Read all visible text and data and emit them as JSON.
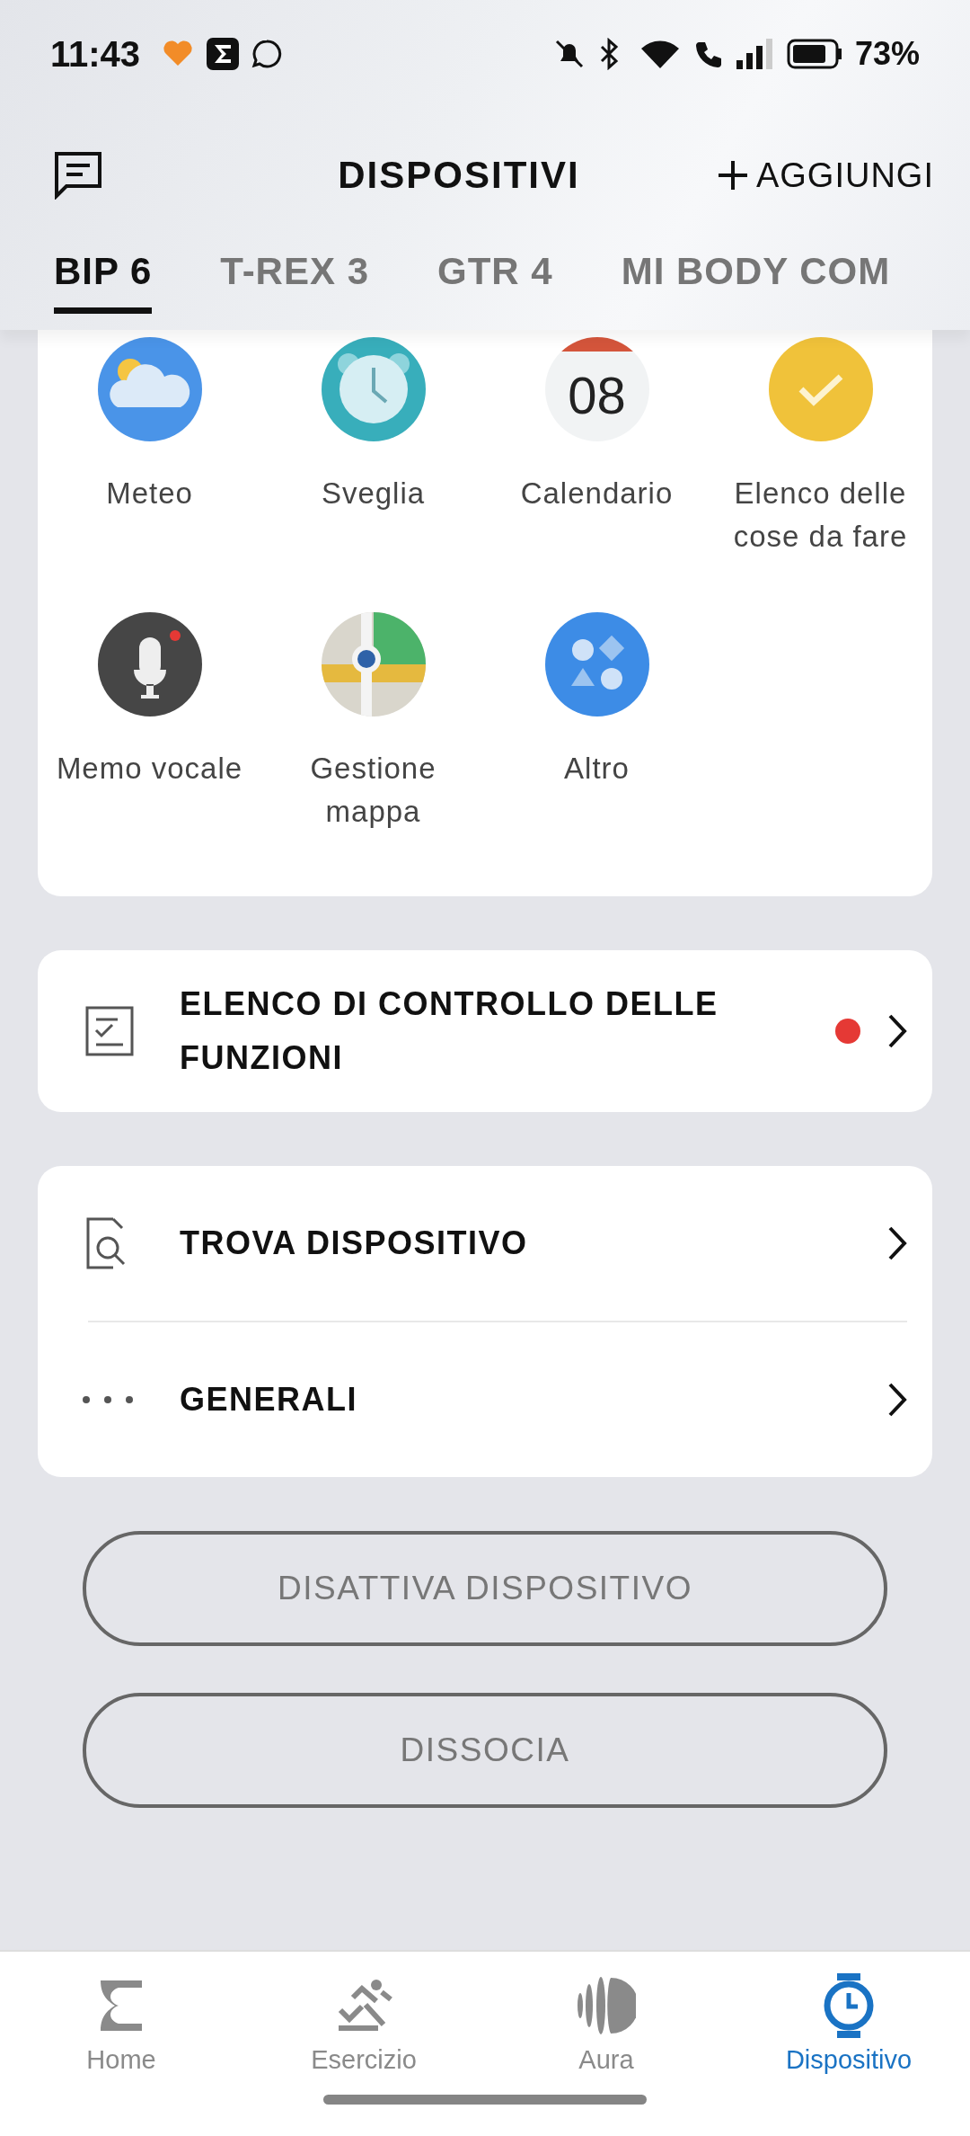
{
  "status_bar": {
    "time": "11:43",
    "battery": "73%"
  },
  "header": {
    "title": "DISPOSITIVI",
    "add_button": "AGGIUNGI"
  },
  "tabs": [
    {
      "label": "BIP 6",
      "selected": true
    },
    {
      "label": "T-REX 3",
      "selected": false
    },
    {
      "label": "GTR 4",
      "selected": false
    },
    {
      "label": "MI BODY COM",
      "selected": false
    }
  ],
  "apps": [
    {
      "label": "Meteo",
      "kind": "weather"
    },
    {
      "label": "Sveglia",
      "kind": "alarm"
    },
    {
      "label": "Calendario",
      "kind": "calendar",
      "icon_text": "08"
    },
    {
      "label": "Elenco delle cose da fare",
      "kind": "todo"
    },
    {
      "label": "Memo vocale",
      "kind": "voice"
    },
    {
      "label": "Gestione mappa",
      "kind": "map"
    },
    {
      "label": "Altro",
      "kind": "more"
    }
  ],
  "checklist": {
    "label": "ELENCO DI CONTROLLO DELLE FUNZIONI",
    "alert": true
  },
  "settings": [
    {
      "label": "TROVA DISPOSITIVO",
      "kind": "find"
    },
    {
      "label": "GENERALI",
      "kind": "general"
    }
  ],
  "actions": [
    "DISATTIVA DISPOSITIVO",
    "DISSOCIA"
  ],
  "nav": [
    {
      "label": "Home",
      "kind": "home",
      "selected": false
    },
    {
      "label": "Esercizio",
      "kind": "exercise",
      "selected": false
    },
    {
      "label": "Aura",
      "kind": "aura",
      "selected": false
    },
    {
      "label": "Dispositivo",
      "kind": "device",
      "selected": true
    }
  ]
}
